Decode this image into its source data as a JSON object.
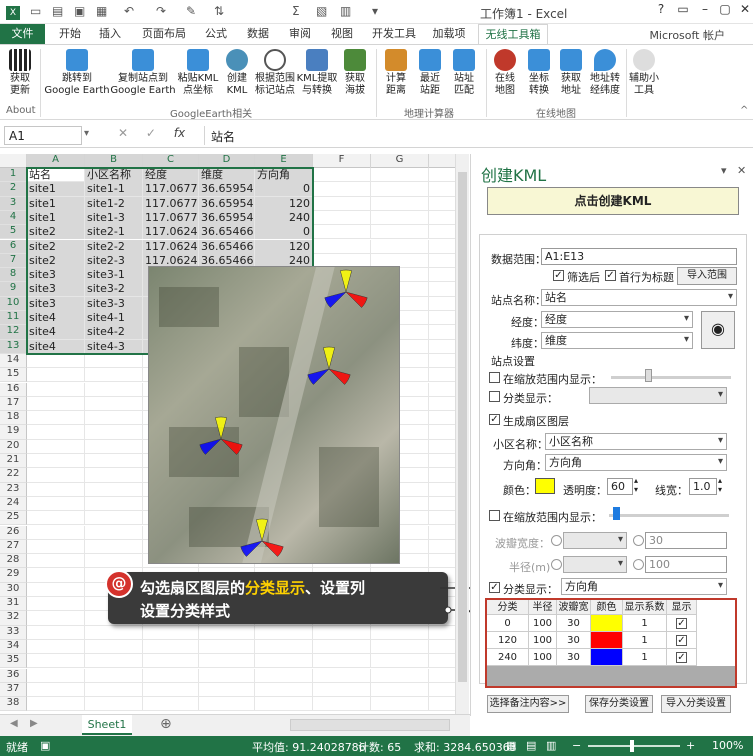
{
  "window": {
    "title": "工作簿1 - Excel"
  },
  "tabs": [
    "文件",
    "开始",
    "插入",
    "页面布局",
    "公式",
    "数据",
    "审阅",
    "视图",
    "开发工具",
    "加载项",
    "无线工具箱"
  ],
  "account": "Microsoft 帐户",
  "ribbon": {
    "buttons": [
      {
        "label": "获取\n更新",
        "color": "#222"
      },
      {
        "label": "跳转到\nGoogle Earth",
        "color": "#3b8fd8"
      },
      {
        "label": "复制站点到\nGoogle Earth",
        "color": "#3b8fd8"
      },
      {
        "label": "粘贴KML\n点坐标",
        "color": "#3b8fd8"
      },
      {
        "label": "创建\nKML",
        "color": "#4a90b8"
      },
      {
        "label": "根据范围\n标记站点",
        "color": "#555"
      },
      {
        "label": "KML提取\n与转换",
        "color": "#4a7fc0"
      },
      {
        "label": "获取\n海拔",
        "color": "#4d8a3a"
      },
      {
        "label": "计算\n距离",
        "color": "#d38b2b"
      },
      {
        "label": "最近\n站距",
        "color": "#3b8fd8"
      },
      {
        "label": "站址\n匹配",
        "color": "#3b8fd8"
      },
      {
        "label": "在线\n地图",
        "color": "#c0392b"
      },
      {
        "label": "坐标\n转换",
        "color": "#3b8fd8"
      },
      {
        "label": "获取\n地址",
        "color": "#3b8fd8"
      },
      {
        "label": "地址转\n经纬度",
        "color": "#3b8fd8"
      },
      {
        "label": "辅助小\n工具",
        "color": "#888"
      }
    ],
    "groups": [
      "About",
      "GoogleEarth相关",
      "地理计算器",
      "在线地图"
    ]
  },
  "formula_bar": {
    "name_box": "A1",
    "formula": "站名"
  },
  "columns": [
    "A",
    "B",
    "C",
    "D",
    "E",
    "F",
    "G"
  ],
  "sheet": {
    "rows": [
      [
        "站名",
        "小区名称",
        "经度",
        "维度",
        "方向角"
      ],
      [
        "site1",
        "site1-1",
        "117.0677",
        "36.65954",
        "0"
      ],
      [
        "site1",
        "site1-2",
        "117.0677",
        "36.65954",
        "120"
      ],
      [
        "site1",
        "site1-3",
        "117.0677",
        "36.65954",
        "240"
      ],
      [
        "site2",
        "site2-1",
        "117.0624",
        "36.65466",
        "0"
      ],
      [
        "site2",
        "site2-2",
        "117.0624",
        "36.65466",
        "120"
      ],
      [
        "site2",
        "site2-3",
        "117.0624",
        "36.65466",
        "240"
      ],
      [
        "site3",
        "site3-1",
        "",
        "",
        ""
      ],
      [
        "site3",
        "site3-2",
        "",
        "",
        ""
      ],
      [
        "site3",
        "site3-3",
        "",
        "",
        ""
      ],
      [
        "site4",
        "site4-1",
        "",
        "",
        ""
      ],
      [
        "site4",
        "site4-2",
        "",
        "",
        ""
      ],
      [
        "site4",
        "site4-3",
        "",
        "",
        ""
      ]
    ],
    "row_numbers": [
      "1",
      "2",
      "3",
      "4",
      "5",
      "6",
      "7",
      "8",
      "9",
      "10",
      "11",
      "12",
      "13",
      "14",
      "15",
      "16",
      "17",
      "18",
      "19",
      "20",
      "21",
      "22",
      "23",
      "24",
      "25",
      "26",
      "27",
      "28",
      "29",
      "30",
      "31",
      "32",
      "33",
      "34",
      "35",
      "36",
      "37",
      "38"
    ]
  },
  "callout": {
    "marker": "@",
    "line1_pre": "勾选扇区图层的",
    "line1_hl": "分类显示",
    "line1_post": "、设置列",
    "line2": "设置分类样式"
  },
  "pane": {
    "title": "创建KML",
    "create_button": "点击创建KML",
    "range_label": "数据范围：",
    "range_value": "A1:E13",
    "filtered": "筛选后",
    "header_row": "首行为标题",
    "import_range": "导入范围",
    "site_name_label": "站点名称：",
    "site_name": "站名",
    "lon_label": "经度：",
    "lon": "经度",
    "lat_label": "纬度：",
    "lat": "维度",
    "site_settings": "站点设置",
    "zoom_show": "在缩放范围内显示：",
    "cat_show": "分类显示：",
    "gen_sector": "生成扇区图层",
    "cell_name_label": "小区名称：",
    "cell_name": "小区名称",
    "azimuth_label": "方向角：",
    "azimuth": "方向角",
    "color_label": "颜色：",
    "transparency_label": "透明度：",
    "transparency": "60",
    "line_width_label": "线宽：",
    "line_width": "1.0",
    "zoom_show2": "在缩放范围内显示：",
    "beam_label": "波瓣宽度：",
    "beam_value": "30",
    "radius_label": "半径(m)",
    "radius_value": "100",
    "cat_show2": "分类显示：",
    "cat_field": "方向角",
    "table_headers": [
      "分类",
      "半径",
      "波瓣宽",
      "颜色",
      "显示系数",
      "显示"
    ],
    "table_rows": [
      {
        "cat": "0",
        "radius": "100",
        "beam": "30",
        "color": "#ffff00",
        "factor": "1",
        "show": "✓"
      },
      {
        "cat": "120",
        "radius": "100",
        "beam": "30",
        "color": "#ff0000",
        "factor": "1",
        "show": "✓"
      },
      {
        "cat": "240",
        "radius": "100",
        "beam": "30",
        "color": "#0000ff",
        "factor": "1",
        "show": "✓"
      }
    ],
    "btn_select_note": "选择备注内容>>",
    "btn_save": "保存分类设置",
    "btn_import": "导入分类设置"
  },
  "sheet_tab": "Sheet1",
  "status": {
    "ready": "就绪",
    "avg": "平均值: 91.24028786",
    "count": "计数: 65",
    "sum": "求和: 3284.650363",
    "zoom": "100%"
  },
  "colors": {
    "excel_green": "#217346",
    "sector_yellow": "#ffff00",
    "sector_red": "#ff0000",
    "sector_blue": "#0000ff"
  }
}
